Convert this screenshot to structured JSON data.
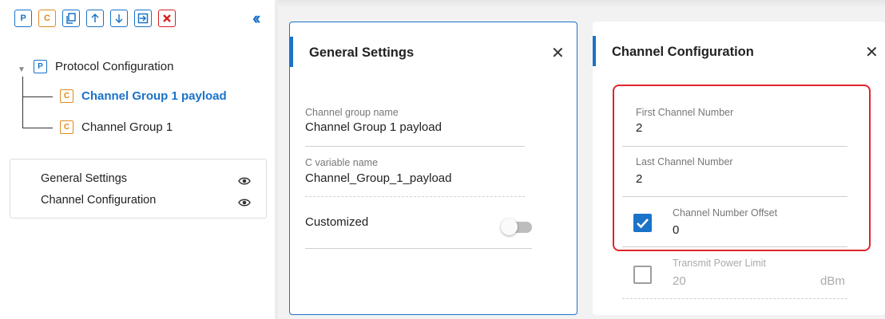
{
  "toolbar": {
    "buttons": [
      {
        "name": "add-protocol",
        "label": "P"
      },
      {
        "name": "add-channel-group",
        "label": "C"
      },
      {
        "name": "copy",
        "icon": "copy-icon"
      },
      {
        "name": "move-up",
        "icon": "arrow-up-icon"
      },
      {
        "name": "move-down",
        "icon": "arrow-down-icon"
      },
      {
        "name": "import",
        "icon": "import-icon"
      },
      {
        "name": "delete",
        "icon": "delete-x-icon"
      }
    ],
    "collapse_icon": "double-chevron-left-icon"
  },
  "tree": {
    "root": {
      "badge": "P",
      "label": "Protocol Configuration"
    },
    "children": [
      {
        "badge": "C",
        "label": "Channel Group 1 payload",
        "selected": true
      },
      {
        "badge": "C",
        "label": "Channel Group 1",
        "selected": false
      }
    ]
  },
  "outline": {
    "items": [
      {
        "label": "General Settings",
        "icon": "eye-icon"
      },
      {
        "label": "Channel Configuration",
        "icon": "eye-icon"
      }
    ]
  },
  "general_settings": {
    "title": "General Settings",
    "fields": {
      "channel_group_name_label": "Channel group name",
      "channel_group_name_value": "Channel Group 1 payload",
      "c_variable_name_label": "C variable name",
      "c_variable_name_value": "Channel_Group_1_payload",
      "customized_label": "Customized",
      "customized_on": false
    }
  },
  "channel_configuration": {
    "title": "Channel Configuration",
    "first_channel_label": "First Channel Number",
    "first_channel_value": "2",
    "last_channel_label": "Last Channel Number",
    "last_channel_value": "2",
    "offset_label": "Channel Number Offset",
    "offset_value": "0",
    "offset_checked": true,
    "power_label": "Transmit Power Limit",
    "power_value": "20",
    "power_unit": "dBm",
    "power_checked": false
  },
  "colors": {
    "accent": "#1a73c9",
    "channel_badge": "#e08a1e",
    "delete": "#d82020",
    "highlight": "#e0242a"
  }
}
